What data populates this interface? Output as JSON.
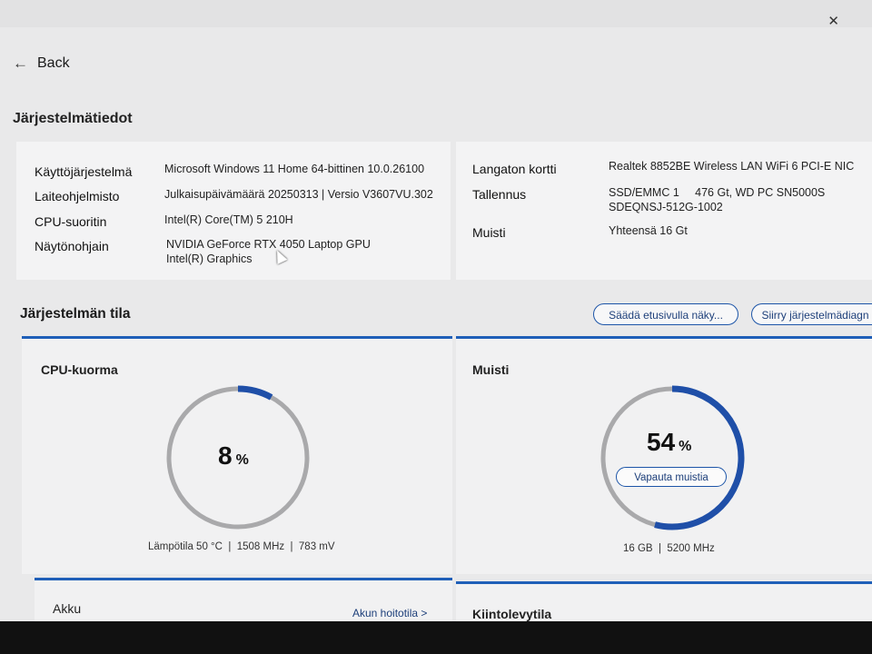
{
  "nav": {
    "back_label": "Back"
  },
  "system_info": {
    "title": "Järjestelmätiedot",
    "left": [
      {
        "label": "Käyttöjärjestelmä",
        "value": "Microsoft Windows 11 Home 64-bittinen 10.0.26100"
      },
      {
        "label": "Laiteohjelmisto",
        "value": "Julkaisupäivämäärä 20250313 | Versio V3607VU.302"
      },
      {
        "label": "CPU-suoritin",
        "value": "Intel(R) Core(TM) 5 210H"
      },
      {
        "label": "Näytönohjain",
        "value": "NVIDIA GeForce RTX 4050 Laptop GPU",
        "value2": "Intel(R) Graphics"
      }
    ],
    "right": [
      {
        "label": "Langaton kortti",
        "value": "Realtek 8852BE Wireless LAN WiFi 6 PCI-E NIC"
      },
      {
        "label": "Tallennus",
        "value": "SSD/EMMC 1     476 Gt, WD PC SN5000S",
        "value2": "SDEQNSJ-512G-1002"
      },
      {
        "label": "Muisti",
        "value": "Yhteensä 16 Gt"
      }
    ]
  },
  "status": {
    "title": "Järjestelmän tila",
    "buttons": [
      "Säädä etusivulla näky...",
      "Siirry järjestelmädiagn"
    ]
  },
  "cpu": {
    "title": "CPU-kuorma",
    "percent": 8,
    "percent_label": "8",
    "unit": "%",
    "details": "Lämpötila 50 °C  |  1508 MHz  |  783 mV"
  },
  "memory": {
    "title": "Muisti",
    "percent": 54,
    "percent_label": "54",
    "unit": "%",
    "free_button": "Vapauta muistia",
    "details": "16 GB  |  5200 MHz"
  },
  "battery": {
    "title": "Akku",
    "link": "Akun hoitotila  >"
  },
  "disk": {
    "title": "Kiintolevytila"
  },
  "colors": {
    "accent": "#1f5fb8",
    "gauge_track": "#a9a9ab",
    "gauge_fill": "#1f4fa8"
  }
}
